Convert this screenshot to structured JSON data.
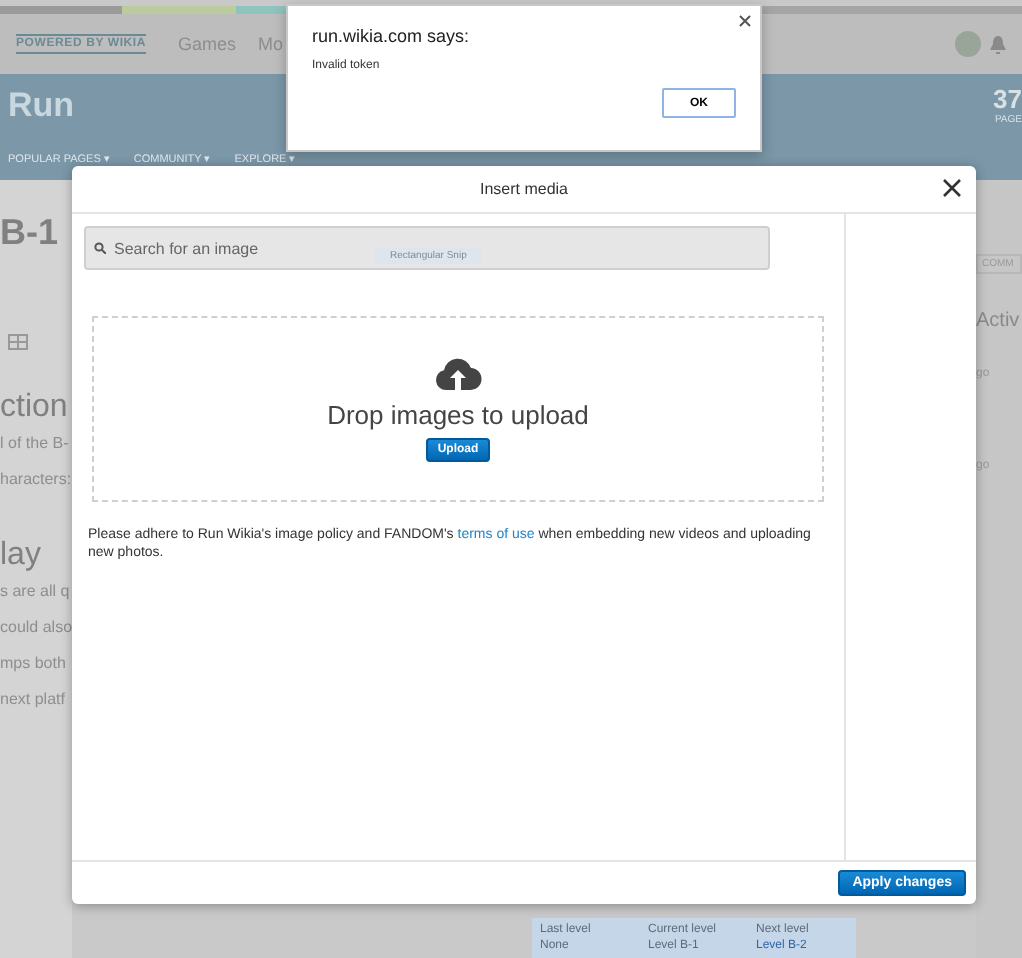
{
  "top_bar": {
    "logo": "POWERED BY WIKIA",
    "links": [
      "Games",
      "Mo"
    ]
  },
  "wiki_header": {
    "title": "Run",
    "count": "37",
    "count_label": "PAGE",
    "nav": [
      "POPULAR PAGES ▾",
      "COMMUNITY ▾",
      "EXPLORE ▾"
    ]
  },
  "article_left": [
    {
      "kind": "heading",
      "text": "B-1"
    },
    {
      "kind": "toolbar"
    },
    {
      "kind": "heading",
      "text": "ction"
    },
    {
      "kind": "text",
      "text": "l of the B-"
    },
    {
      "kind": "text",
      "text": "haracters:"
    },
    {
      "kind": "heading",
      "text": "lay"
    },
    {
      "kind": "text",
      "text": "s are all q"
    },
    {
      "kind": "text",
      "text": "could also"
    },
    {
      "kind": "text",
      "text": "mps both"
    },
    {
      "kind": "text",
      "text": "next platf"
    }
  ],
  "rail_right": [
    {
      "kind": "button",
      "text": "COMM"
    },
    {
      "kind": "heading",
      "text": "Activ"
    },
    {
      "kind": "text",
      "text": "go"
    },
    {
      "kind": "text",
      "text": "go"
    }
  ],
  "level_table": {
    "columns": [
      "Last level",
      "Current level",
      "Next level"
    ],
    "rows": [
      [
        {
          "text": "None",
          "link": false
        },
        {
          "text": "Level B-1",
          "link": false
        },
        {
          "text": "Level B-2",
          "link": true
        }
      ]
    ]
  },
  "modal": {
    "title": "Insert media",
    "search": {
      "placeholder": "Search for an image"
    },
    "snip_label": "Rectangular Snip",
    "drop_text": "Drop images to upload",
    "upload_button": "Upload",
    "policy": "Please adhere to Run Wikia's image policy and FANDOM's ",
    "policy_link": "terms of use",
    "policy_tail": " when embedding new videos and uploading new photos.",
    "apply_button": "Apply changes"
  },
  "alert": {
    "title": "run.wikia.com says:",
    "message": "Invalid token",
    "ok_button": "OK"
  }
}
